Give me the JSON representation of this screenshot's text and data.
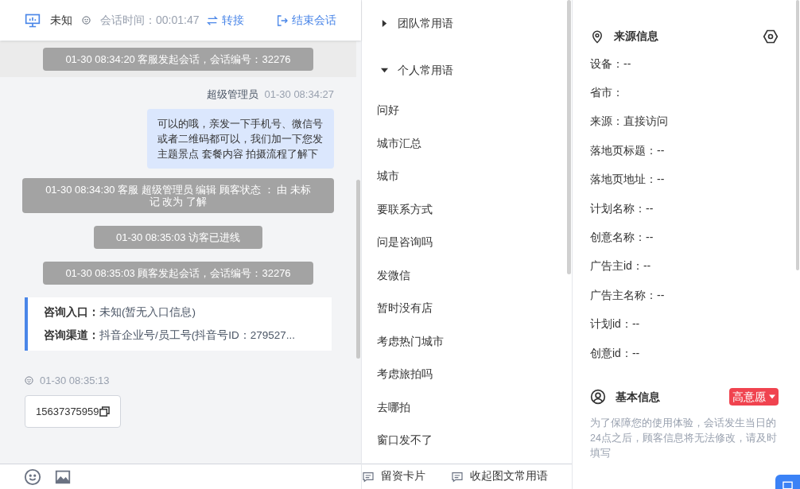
{
  "header": {
    "channel": "未知",
    "session_time": "会话时间：00:01:47",
    "actions": [
      {
        "label": "转接",
        "kind": "transfer"
      },
      {
        "label": "结束会话",
        "kind": "end"
      }
    ]
  },
  "messages": [
    {
      "kind": "banner",
      "text": "01-30 08:34:20 客服发起会话，会话编号：32276"
    },
    {
      "kind": "agent",
      "sender": "超级管理员",
      "time": "01-30 08:34:27",
      "text": "可以的哦，亲发一下手机号、微信号或者二维码都可以，我们加一下您发主题景点 套餐内容 拍摄流程了解下"
    },
    {
      "kind": "notice",
      "text": "01-30 08:34:30 客服 超级管理员 编辑 顾客状态 ： 由 未标记 改为 了解"
    },
    {
      "kind": "notice",
      "text": "01-30 08:35:03 访客已进线"
    },
    {
      "kind": "notice",
      "text": "01-30 08:35:03 顾客发起会话，会话编号：32276"
    },
    {
      "kind": "info",
      "rows": [
        {
          "label": "咨询入口：",
          "value": "未知(暂无入口信息)"
        },
        {
          "label": "咨询渠道：",
          "value": "抖音企业号/员工号(抖音号ID：279527..."
        }
      ]
    },
    {
      "kind": "visitor",
      "time": "01-30 08:35:13",
      "text": "15637375959"
    }
  ],
  "quick_replies": [
    {
      "title": "团队常用语",
      "expanded": false
    },
    {
      "title": "个人常用语",
      "expanded": true,
      "items": [
        "问好",
        "城市汇总",
        "城市",
        "要联系方式",
        "问是咨询吗",
        "发微信",
        "暂时没有店",
        "考虑热门城市",
        "考虑旅拍吗",
        "去哪拍",
        "窗口发不了"
      ]
    }
  ],
  "footer_buttons": [
    "留资卡片",
    "收起图文常用语"
  ],
  "source_info": {
    "title": "来源信息",
    "fields": [
      "设备：--",
      "省市：",
      "来源：直接访问",
      "落地页标题：--",
      "落地页地址：--",
      "计划名称：--",
      "创意名称：--",
      "广告主id：--",
      "广告主名称：--",
      "计划id：--",
      "创意id：--"
    ]
  },
  "basic_info": {
    "title": "基本信息",
    "tag": "高意愿",
    "note": "为了保障您的使用体验，会话发生当日的24点之后，顾客信息将无法修改，请及时填写"
  }
}
